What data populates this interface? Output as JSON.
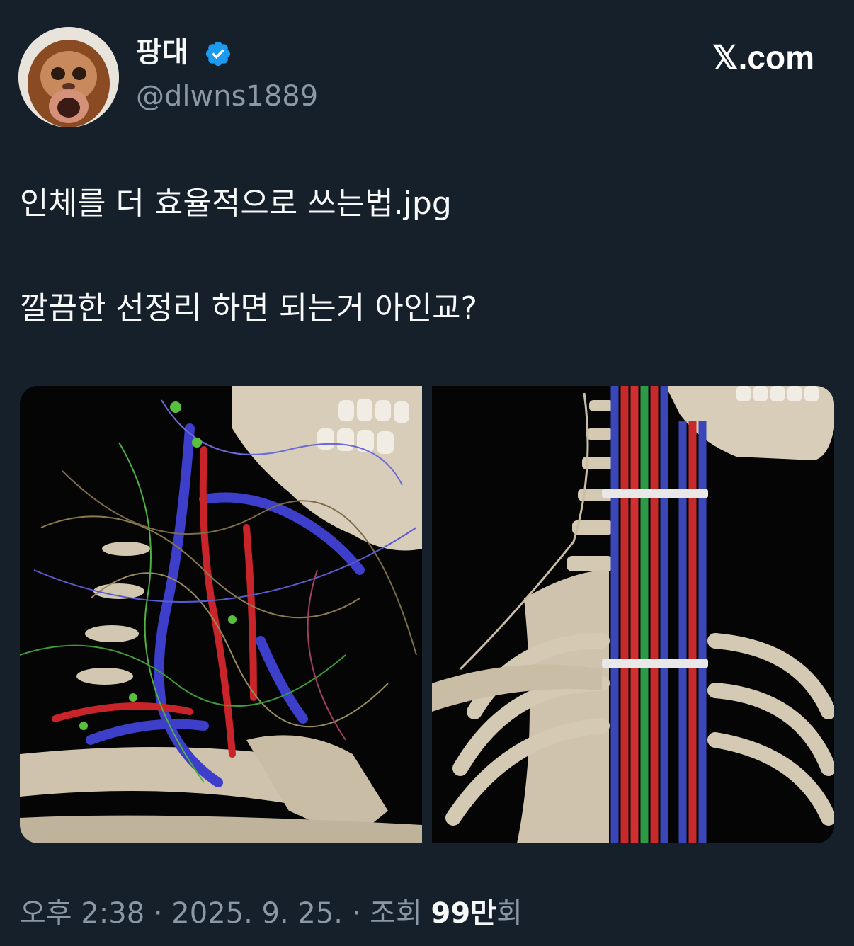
{
  "author": {
    "display_name": "팡대",
    "handle": "@dlwns1889",
    "avatar_icon": "orangutan-avatar",
    "verified": true
  },
  "brand": {
    "label": "𝕏.com"
  },
  "tweet": {
    "line1": "인체를 더 효율적으로 쓰는법.jpg",
    "line2": "깔끔한 선정리 하면 되는거 아인교?"
  },
  "meta": {
    "time": "오후 2:38",
    "date": "2025. 9. 25.",
    "sep": " · ",
    "views_prefix": "조회 ",
    "views_count": "99만",
    "views_suffix": "회"
  },
  "colors": {
    "background": "#15202b",
    "text_primary": "#f7f9f9",
    "text_secondary": "#8b98a5",
    "verified_blue": "#1d9bf0"
  }
}
